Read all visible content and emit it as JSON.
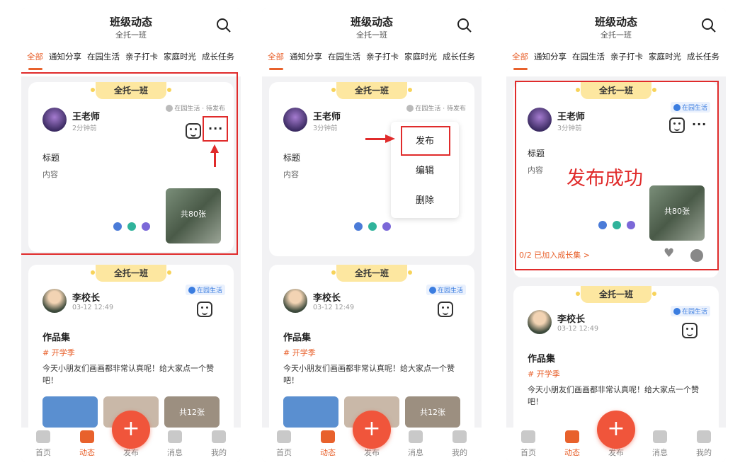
{
  "header": {
    "title": "班级动态",
    "subtitle": "全托一班"
  },
  "tabs": [
    "全部",
    "通知分享",
    "在园生活",
    "亲子打卡",
    "家庭时光",
    "成长任务"
  ],
  "post1": {
    "class_label": "全托一班",
    "author": "王老师",
    "time_a": "2分钟前",
    "time_b": "3分钟前",
    "tag_pending": "在园生活 · 待发布",
    "tag_published": "在园生活",
    "title": "标题",
    "content": "内容",
    "photo_count": "共80张"
  },
  "menu": {
    "publish": "发布",
    "edit": "编辑",
    "delete": "删除"
  },
  "success_text": "发布成功",
  "growth_link": "0/2 已加入成长集 >",
  "post2": {
    "class_label": "全托一班",
    "author": "李校长",
    "time": "03-12 12:49",
    "tag": "在园生活",
    "title": "作品集",
    "hashtag": "# 开学季",
    "desc": "今天小朋友们画画都非常认真呢！给大家点一个赞吧！",
    "photo_count": "共12张"
  },
  "bottom_nav": {
    "home": "首页",
    "feed": "动态",
    "publish": "发布",
    "messages": "消息",
    "mine": "我的"
  },
  "colors": {
    "accent": "#e8612c",
    "highlight": "#e02b2b",
    "class_badge": "#fde7a0"
  }
}
